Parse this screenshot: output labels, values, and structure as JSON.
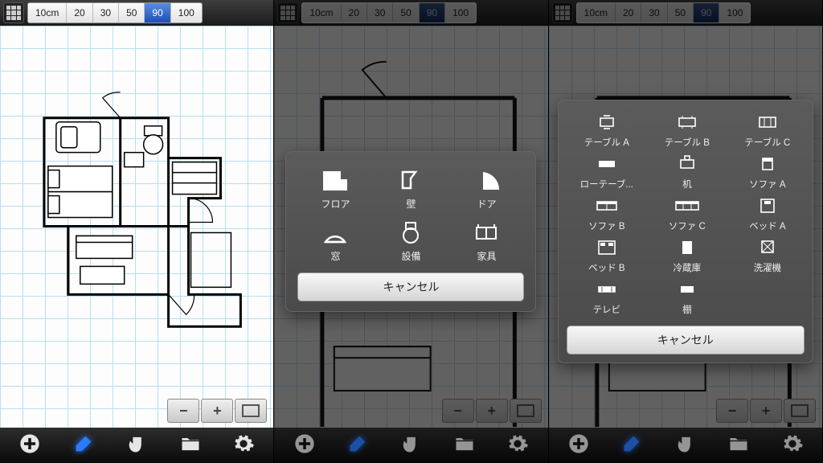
{
  "ruler": {
    "segments": [
      "10cm",
      "20",
      "30",
      "50",
      "90",
      "100"
    ],
    "selected_index": 4
  },
  "bottom_tools": [
    "add",
    "draw",
    "pan",
    "folder",
    "settings"
  ],
  "active_tool_index": 1,
  "zoom": {
    "out": "−",
    "in": "+",
    "fit": "fit"
  },
  "modal_categories": {
    "items": [
      {
        "id": "floor",
        "label": "フロア"
      },
      {
        "id": "wall",
        "label": "壁"
      },
      {
        "id": "door",
        "label": "ドア"
      },
      {
        "id": "window",
        "label": "窓"
      },
      {
        "id": "equipment",
        "label": "設備"
      },
      {
        "id": "furniture",
        "label": "家具"
      }
    ],
    "cancel": "キャンセル"
  },
  "modal_furniture": {
    "items": [
      {
        "id": "table-a",
        "label": "テーブル A"
      },
      {
        "id": "table-b",
        "label": "テーブル B"
      },
      {
        "id": "table-c",
        "label": "テーブル C"
      },
      {
        "id": "low-table",
        "label": "ローテーブ..."
      },
      {
        "id": "desk",
        "label": "机"
      },
      {
        "id": "sofa-a",
        "label": "ソファ A"
      },
      {
        "id": "sofa-b",
        "label": "ソファ B"
      },
      {
        "id": "sofa-c",
        "label": "ソファ C"
      },
      {
        "id": "bed-a",
        "label": "ベッド A"
      },
      {
        "id": "bed-b",
        "label": "ベッド B"
      },
      {
        "id": "fridge",
        "label": "冷蔵庫"
      },
      {
        "id": "washer",
        "label": "洗濯機"
      },
      {
        "id": "tv",
        "label": "テレビ"
      },
      {
        "id": "shelf",
        "label": "棚"
      }
    ],
    "cancel": "キャンセル"
  }
}
